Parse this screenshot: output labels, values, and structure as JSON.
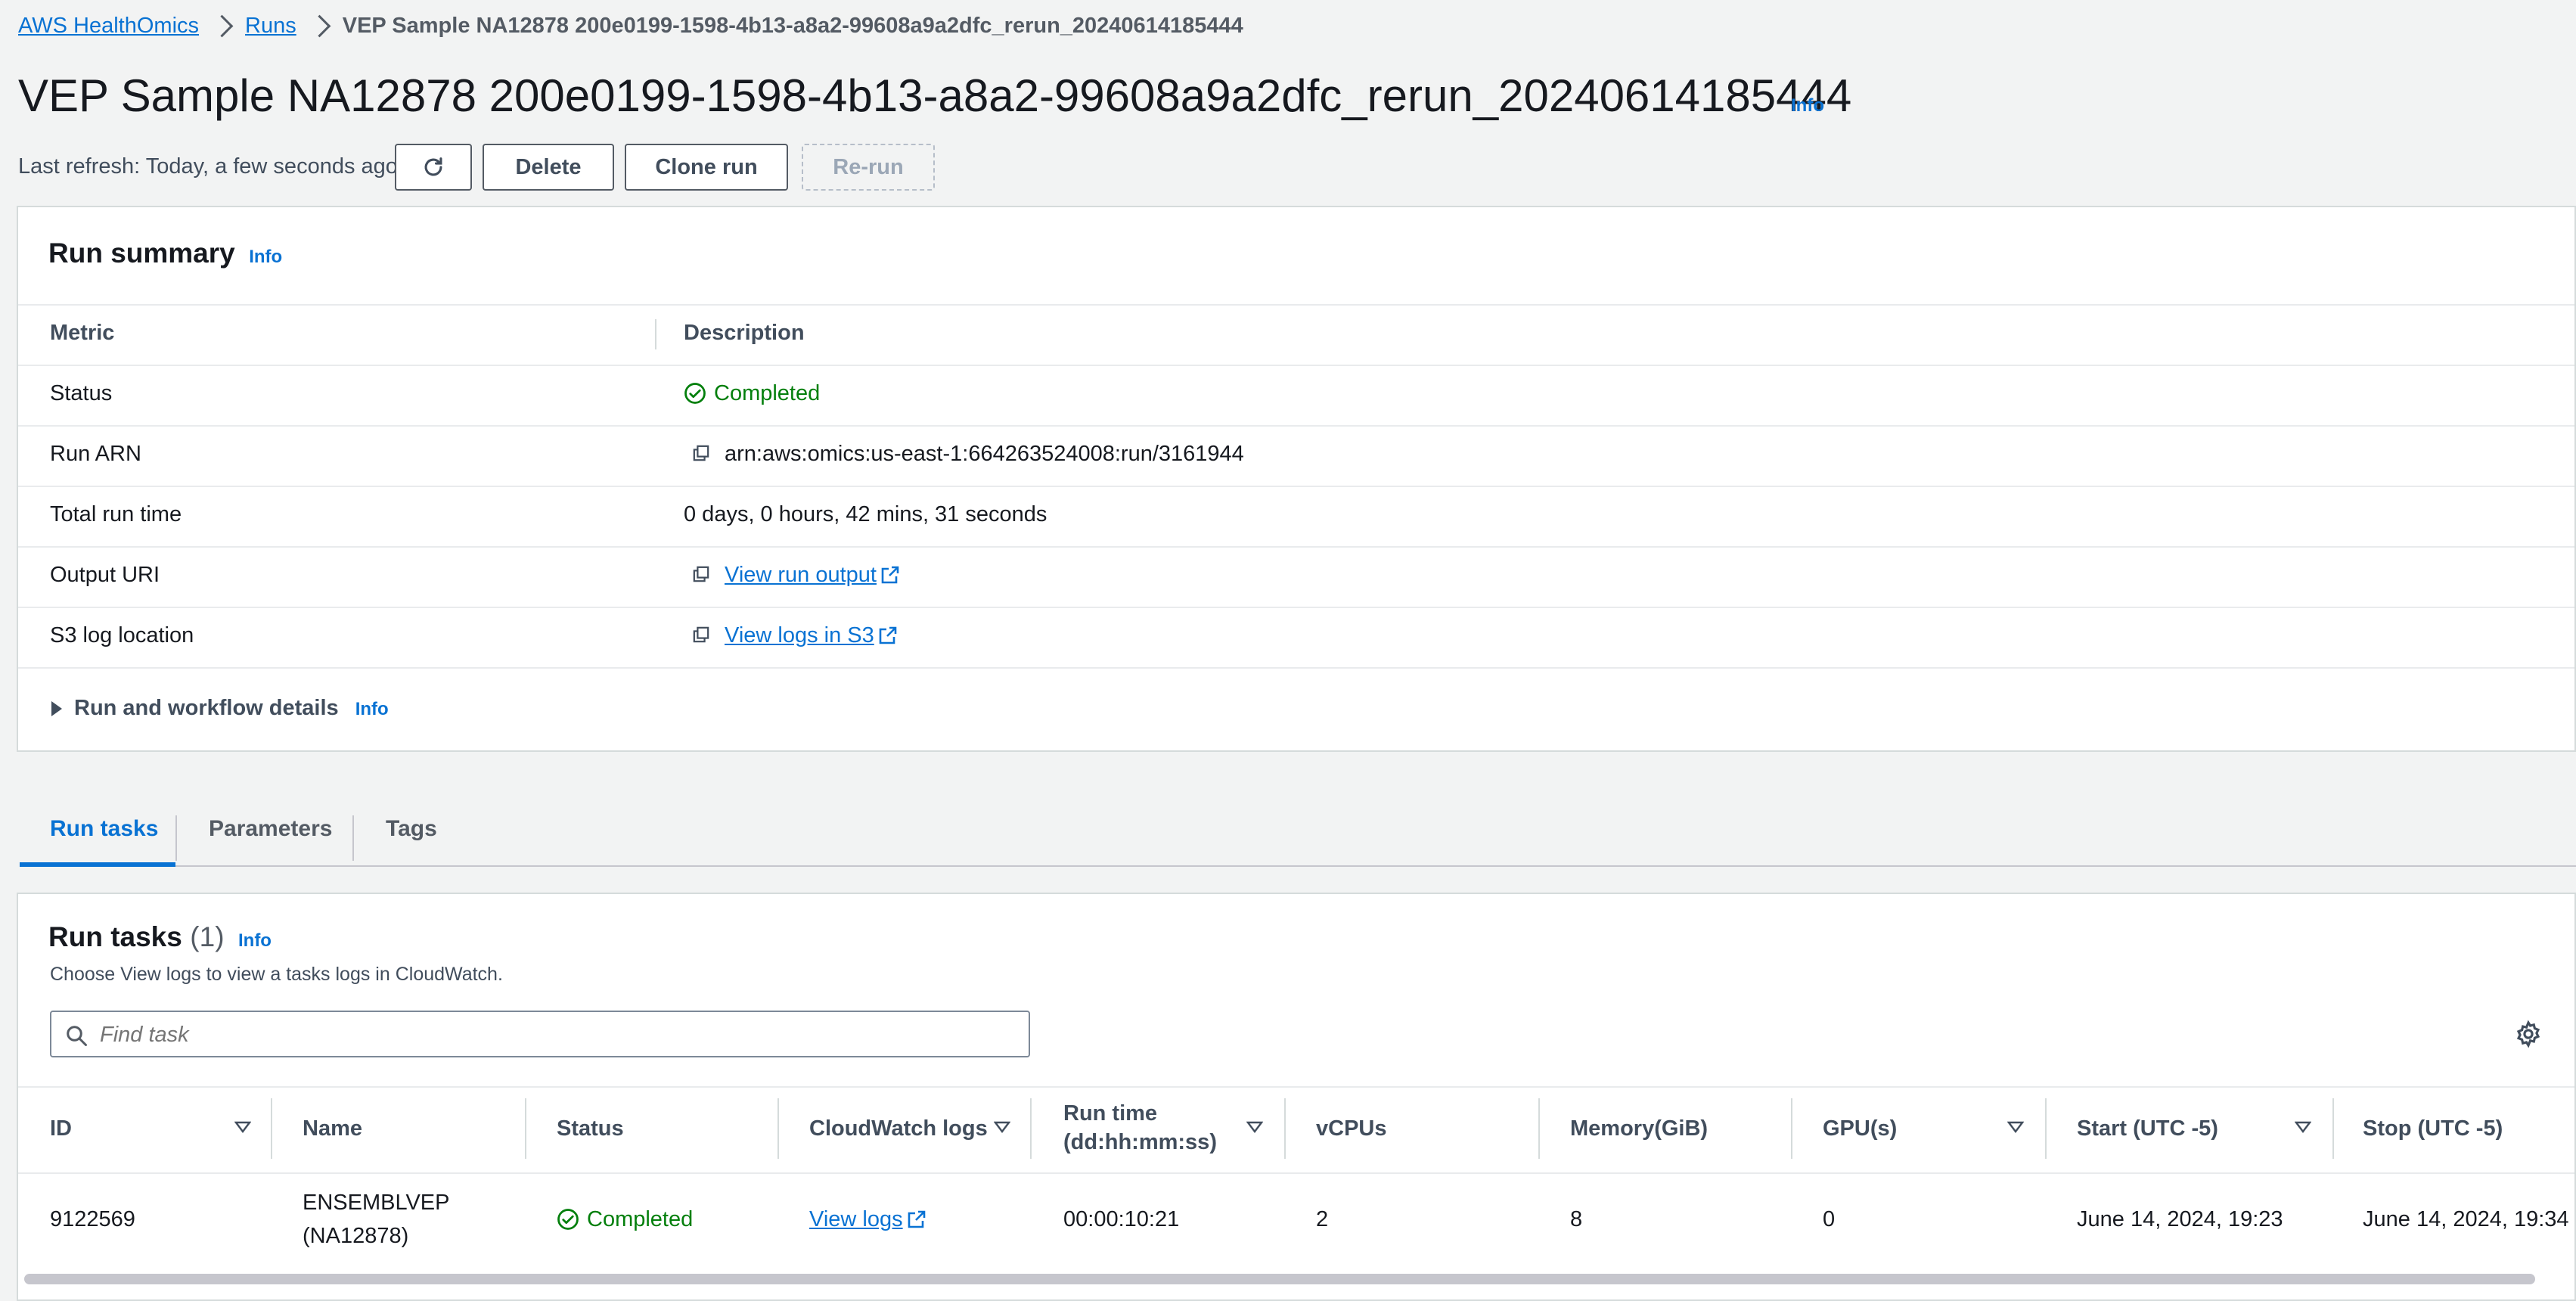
{
  "breadcrumb": {
    "items": [
      "AWS HealthOmics",
      "Runs"
    ],
    "current": "VEP Sample NA12878 200e0199-1598-4b13-a8a2-99608a9a2dfc_rerun_20240614185444"
  },
  "page": {
    "title": "VEP Sample NA12878 200e0199-1598-4b13-a8a2-99608a9a2dfc_rerun_20240614185444",
    "info": "Info",
    "refresh_text": "Last refresh: Today, a few seconds ago"
  },
  "actions": {
    "delete": "Delete",
    "clone": "Clone run",
    "rerun": "Re-run"
  },
  "summary": {
    "title": "Run summary",
    "info": "Info",
    "headers": {
      "metric": "Metric",
      "description": "Description"
    },
    "rows": {
      "status": {
        "label": "Status",
        "value": "Completed"
      },
      "arn": {
        "label": "Run ARN",
        "value": "arn:aws:omics:us-east-1:664263524008:run/3161944"
      },
      "runtime": {
        "label": "Total run time",
        "value": "0 days, 0 hours, 42 mins, 31 seconds"
      },
      "output": {
        "label": "Output URI",
        "value": "View run output"
      },
      "logs": {
        "label": "S3 log location",
        "value": "View logs in S3"
      }
    },
    "details": {
      "label": "Run and workflow details",
      "info": "Info"
    }
  },
  "tabs": [
    "Run tasks",
    "Parameters",
    "Tags"
  ],
  "tasks": {
    "title": "Run tasks",
    "count": "(1)",
    "info": "Info",
    "description": "Choose View logs to view a tasks logs in CloudWatch.",
    "search_placeholder": "Find task",
    "columns": {
      "id": "ID",
      "name": "Name",
      "status": "Status",
      "cw_logs": "CloudWatch logs",
      "runtime_1": "Run time",
      "runtime_2": "(dd:hh:mm:ss)",
      "vcpus": "vCPUs",
      "memory": "Memory(GiB)",
      "gpus": "GPU(s)",
      "start": "Start (UTC -5)",
      "stop": "Stop (UTC -5)"
    },
    "row": {
      "id": "9122569",
      "name_1": "ENSEMBLVEP",
      "name_2": "(NA12878)",
      "status": "Completed",
      "logs": "View logs",
      "runtime": "00:00:10:21",
      "vcpus": "2",
      "memory": "8",
      "gpus": "0",
      "start": "June 14, 2024, 19:23",
      "stop": "June 14, 2024, 19:34"
    }
  },
  "colors": {
    "link": "#0972d3",
    "success": "#037f0c",
    "text": "#16191f",
    "background": "#f2f3f3"
  }
}
